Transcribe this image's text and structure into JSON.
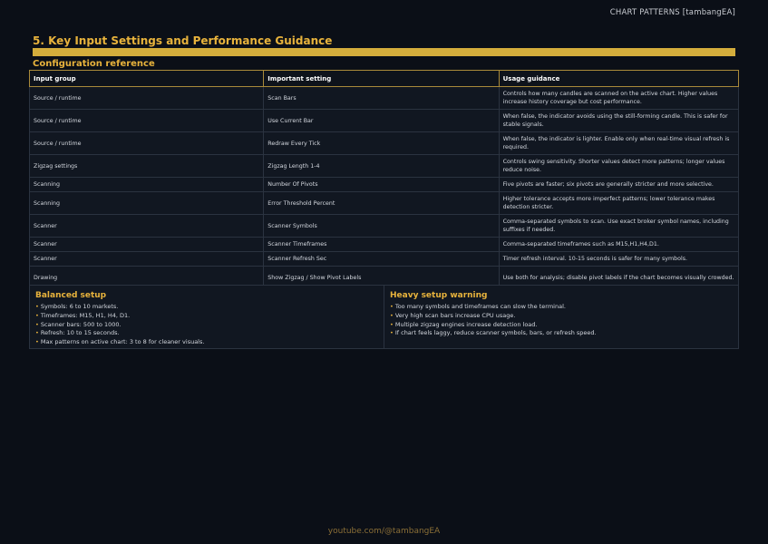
{
  "header": {
    "brand": "CHART PATTERNS [tambangEA]"
  },
  "section": {
    "title": "5. Key Input Settings and Performance Guidance",
    "subtitle": "Configuration reference"
  },
  "table": {
    "headers": [
      "Input group",
      "Important setting",
      "Usage guidance"
    ],
    "rows": [
      [
        "Source / runtime",
        "Scan Bars",
        "Controls how many candles are scanned on the active chart. Higher values increase history coverage but cost performance."
      ],
      [
        "Source / runtime",
        "Use Current Bar",
        "When false, the indicator avoids using the still-forming candle. This is safer for stable signals."
      ],
      [
        "Source / runtime",
        "Redraw Every Tick",
        "When false, the indicator is lighter. Enable only when real-time visual refresh is required."
      ],
      [
        "Zigzag settings",
        "Zigzag Length 1-4",
        "Controls swing sensitivity. Shorter values detect more patterns; longer values reduce noise."
      ],
      [
        "Scanning",
        "Number Of Pivots",
        "Five pivots are faster; six pivots are generally stricter and more selective."
      ],
      [
        "Scanning",
        "Error Threshold Percent",
        "Higher tolerance accepts more imperfect patterns; lower tolerance makes detection stricter."
      ],
      [
        "Scanner",
        "Scanner Symbols",
        "Comma-separated symbols to scan. Use exact broker symbol names, including suffixes if needed."
      ],
      [
        "Scanner",
        "Scanner Timeframes",
        "Comma-separated timeframes such as M15,H1,H4,D1."
      ],
      [
        "Scanner",
        "Scanner Refresh Sec",
        "Timer refresh interval. 10-15 seconds is safer for many symbols."
      ],
      [
        "Drawing",
        "Show Zigzag / Show Pivot Labels",
        "Use both for analysis; disable pivot labels if the chart becomes visually crowded."
      ]
    ]
  },
  "balanced": {
    "title": "Balanced setup",
    "items": [
      "Symbols: 6 to 10 markets.",
      "Timeframes: M15, H1, H4, D1.",
      "Scanner bars: 500 to 1000.",
      "Refresh: 10 to 15 seconds.",
      "Max patterns on active chart: 3 to 8 for cleaner visuals."
    ]
  },
  "heavy": {
    "title": "Heavy setup warning",
    "items": [
      "Too many symbols and timeframes can slow the terminal.",
      "Very high scan bars increase CPU usage.",
      "Multiple zigzag engines increase detection load.",
      "If chart feels laggy, reduce scanner symbols, bars, or refresh speed."
    ]
  },
  "footer": {
    "text": "youtube.com/@tambangEA"
  },
  "colors": {
    "accent": "#e8b33c",
    "background": "#0b0f17",
    "bar": "#d4ad3c"
  }
}
